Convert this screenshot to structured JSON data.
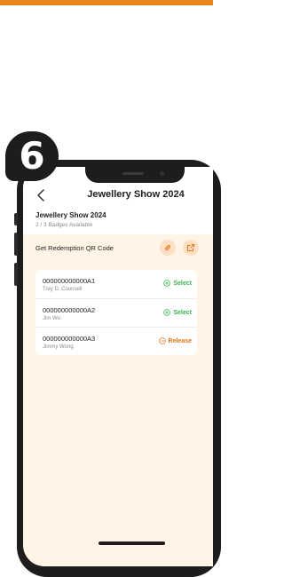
{
  "step": {
    "number": "6"
  },
  "header": {
    "title": "Jewellery Show 2024",
    "back_icon": "chevron-left-icon"
  },
  "event": {
    "title": "Jewellery Show 2024",
    "subtitle": "2 / 3 Badges Available"
  },
  "redemption": {
    "label": "Get Redemption QR Code",
    "link_icon": "link-icon",
    "share_icon": "external-link-icon"
  },
  "badges": [
    {
      "code": "000000000000A1",
      "name": "Trey D. Counsell",
      "action": "Select",
      "status": "select"
    },
    {
      "code": "000000000000A2",
      "name": "Jim Wu",
      "action": "Select",
      "status": "select"
    },
    {
      "code": "000000000000A3",
      "name": "Jimmy Wong",
      "action": "Release",
      "status": "release"
    }
  ],
  "colors": {
    "accent": "#e8841a",
    "select": "#37b24d",
    "release": "#e8731a",
    "background": "#fff4e6"
  }
}
